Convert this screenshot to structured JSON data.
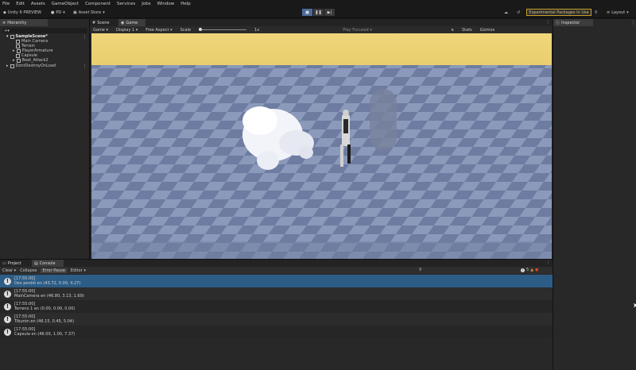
{
  "menu": [
    "File",
    "Edit",
    "Assets",
    "GameObject",
    "Component",
    "Services",
    "Jobs",
    "Window",
    "Help"
  ],
  "toolbar": {
    "version": "Unity 6 PREVIEW",
    "account": "PD",
    "asset_store": "Asset Store",
    "experimental": "Experimental Packages In Use",
    "layout": "Layout"
  },
  "hierarchy": {
    "tab": "Hierarchy",
    "items": [
      "SampleScene*",
      "Main Camera",
      "Terrain",
      "PlayerArmature",
      "Capsule",
      "Beat_Attack2",
      "DontDestroyOnLoad"
    ]
  },
  "game": {
    "tabs": [
      "Scene",
      "Game"
    ],
    "display": "Display 1",
    "aspect": "Free Aspect",
    "scale_label": "Scale",
    "scale_value": "1x",
    "play_focused": "Play Focused",
    "stats": "Stats",
    "gizmos": "Gizmos"
  },
  "inspector": {
    "tab": "Inspector"
  },
  "console": {
    "tabs": [
      "Project",
      "Console"
    ],
    "buttons": [
      "Clear",
      "Collapse",
      "Error Pause",
      "Editor"
    ],
    "count": "5",
    "logs": [
      {
        "time": "[17:55:00]",
        "msg": "Oso perdió en (43.72, 0.00, 4.27)",
        "selected": true
      },
      {
        "time": "[17:55:00]",
        "msg": "MainCamera en (46.80, 3.13, 1.69)",
        "selected": false
      },
      {
        "time": "[17:55:00]",
        "msg": "Terreno 1 en (0.00, 0.00, 0.00)",
        "selected": false
      },
      {
        "time": "[17:55:00]",
        "msg": "Tiburón en (46.15, 0.45, 5.04)",
        "selected": false
      },
      {
        "time": "[17:55:00]",
        "msg": "Capsula en (46.00, 1.00, 7.37)",
        "selected": false
      }
    ]
  },
  "colors": {
    "accent": "#4b6a9c",
    "selected_row": "#2c5d87",
    "warning": "#c7a22e"
  }
}
